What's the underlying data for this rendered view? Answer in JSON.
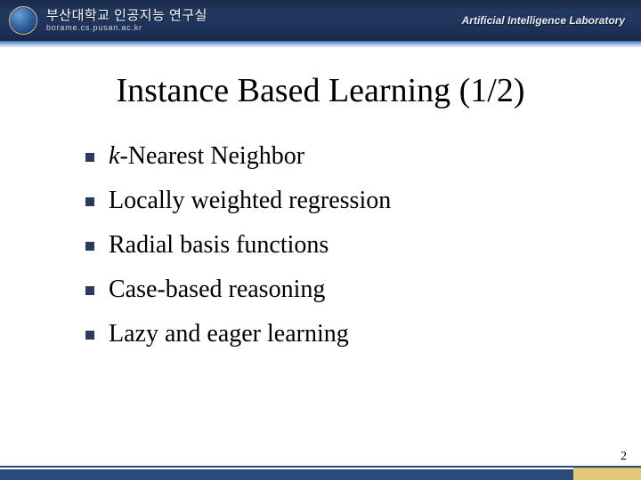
{
  "header": {
    "university_kr": "부산대학교 인공지능 연구실",
    "url": "borame.cs.pusan.ac.kr",
    "lab": "Artificial Intelligence Laboratory"
  },
  "title": "Instance Based Learning (1/2)",
  "bullets": [
    {
      "italic_prefix": "k",
      "rest": "-Nearest Neighbor"
    },
    {
      "text": "Locally weighted regression"
    },
    {
      "text": "Radial basis functions"
    },
    {
      "text": "Case-based reasoning"
    },
    {
      "text": "Lazy and eager learning"
    }
  ],
  "page_number": "2"
}
